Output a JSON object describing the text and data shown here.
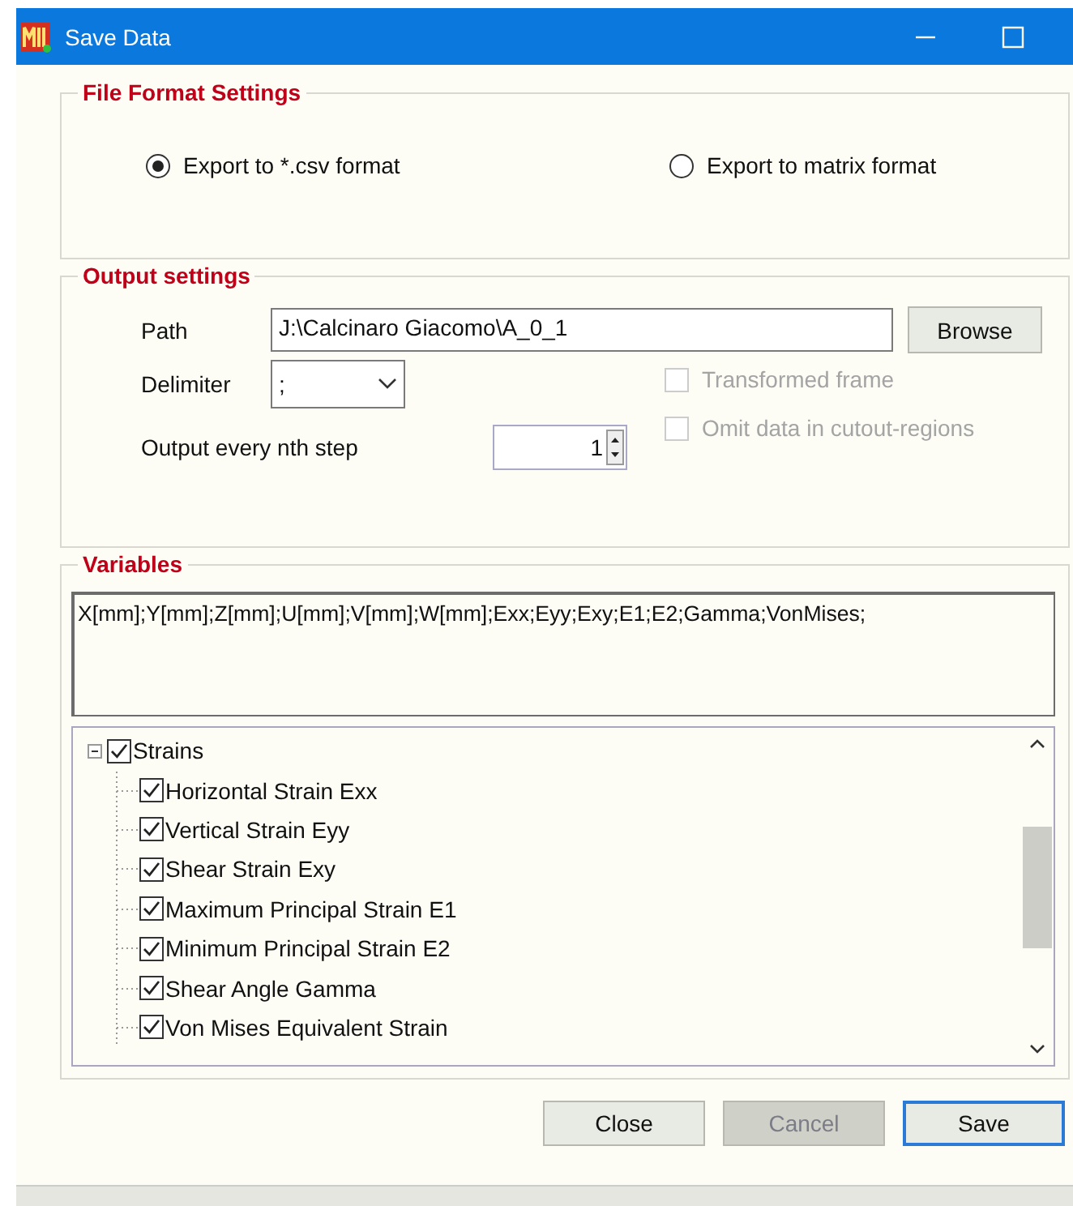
{
  "window": {
    "title": "Save Data"
  },
  "file_format": {
    "title": "File Format Settings",
    "options": [
      {
        "label": "Export to *.csv format",
        "selected": true
      },
      {
        "label": "Export to matrix format",
        "selected": false
      }
    ]
  },
  "output": {
    "title": "Output settings",
    "path_label": "Path",
    "path_value": "J:\\Calcinaro Giacomo\\A_0_1",
    "browse": "Browse",
    "delimiter_label": "Delimiter",
    "delimiter_value": ";",
    "step_label": "Output every nth step",
    "step_value": "1",
    "options": [
      {
        "label": "Transformed frame",
        "checked": false,
        "disabled": true
      },
      {
        "label": "Omit data in cutout-regions",
        "checked": false,
        "disabled": true
      }
    ]
  },
  "variables": {
    "title": "Variables",
    "text": "X[mm];Y[mm];Z[mm];U[mm];V[mm];W[mm];Exx;Eyy;Exy;E1;E2;Gamma;VonMises;",
    "tree": [
      {
        "label": "Strains",
        "checked": true,
        "expanded": true,
        "children": [
          {
            "label": "Horizontal Strain Exx",
            "checked": true
          },
          {
            "label": "Vertical Strain Eyy",
            "checked": true
          },
          {
            "label": "Shear Strain Exy",
            "checked": true
          },
          {
            "label": "Maximum Principal Strain E1",
            "checked": true
          },
          {
            "label": "Minimum Principal Strain E2",
            "checked": true
          },
          {
            "label": "Shear Angle Gamma",
            "checked": true
          },
          {
            "label": "Von Mises Equivalent Strain",
            "checked": true
          }
        ]
      }
    ]
  },
  "buttons": [
    {
      "label": "Close",
      "disabled": false,
      "default": false
    },
    {
      "label": "Cancel",
      "disabled": true,
      "default": false
    },
    {
      "label": "Save",
      "disabled": false,
      "default": true
    }
  ]
}
